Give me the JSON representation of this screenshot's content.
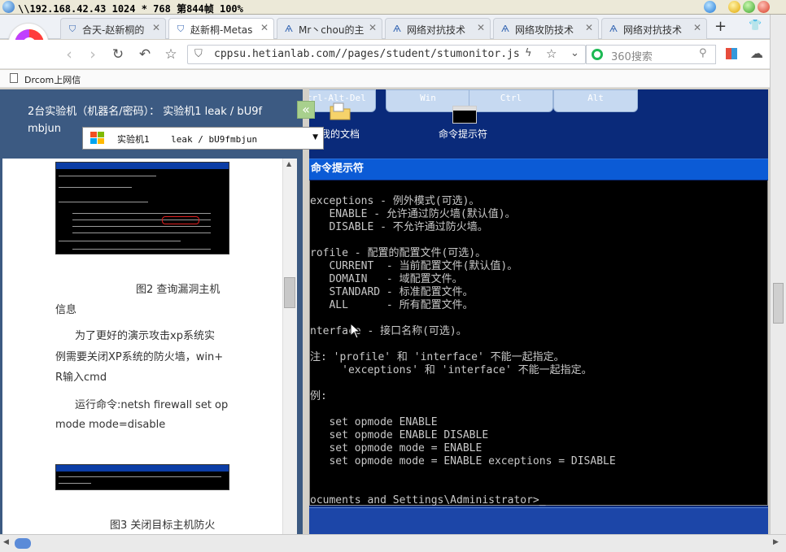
{
  "window": {
    "title": "\\\\192.168.42.43 1024 * 768 第844帧 100%"
  },
  "tabs": [
    {
      "label": "合天-赵新桐的",
      "icon": "shield-icon"
    },
    {
      "label": "赵新桐-Metas",
      "icon": "shield-icon",
      "active": true
    },
    {
      "label": "Mr丶chou的主",
      "icon": "hetian-icon"
    },
    {
      "label": "网络对抗技术",
      "icon": "hetian-icon"
    },
    {
      "label": "网络攻防技术",
      "icon": "hetian-icon"
    },
    {
      "label": "网络对抗技术",
      "icon": "hetian-icon"
    }
  ],
  "nav": {
    "url": "cppsu.hetianlab.com//pages/student/stumonitor.js",
    "search_placeholder": "360搜索"
  },
  "bookmarks": {
    "item1": "Drcom上网信"
  },
  "lab": {
    "info_line1": "2台实验机（机器名/密码）： 实验机1   leak / bU9f",
    "info_line2": "mbjun",
    "dropdown_label": "实验机1",
    "dropdown_cred": "leak / bU9fmbjun"
  },
  "doc": {
    "fig2_caption": "图2 查询漏洞主机",
    "fig2_caption2": "信息",
    "para1_l1": "为了更好的演示攻击xp系统实",
    "para1_l2": "例需要关闭XP系统的防火墙，win+",
    "para1_l3": "R输入cmd",
    "para2_l1": "运行命令:netsh firewall set op",
    "para2_l2": "mode mode=disable",
    "fig3_caption": "图3 关闭目标主机防火"
  },
  "remote": {
    "keys": [
      "Ctrl-Alt-Del",
      "Win",
      "Ctrl",
      "Alt"
    ],
    "desktop_icon1": "我的文档",
    "desktop_icon2": "命令提示符",
    "cmd_title": "命令提示符",
    "cmd_lines": [
      "exceptions - 例外模式(可选)。",
      "   ENABLE - 允许通过防火墙(默认值)。",
      "   DISABLE - 不允许通过防火墙。",
      "",
      "rofile - 配置的配置文件(可选)。",
      "   CURRENT  - 当前配置文件(默认值)。",
      "   DOMAIN   - 域配置文件。",
      "   STANDARD - 标准配置文件。",
      "   ALL      - 所有配置文件。",
      "",
      "nterface - 接口名称(可选)。",
      "",
      "注: 'profile' 和 'interface' 不能一起指定。",
      "     'exceptions' 和 'interface' 不能一起指定。",
      "",
      "例:",
      "",
      "   set opmode ENABLE",
      "   set opmode ENABLE DISABLE",
      "   set opmode mode = ENABLE",
      "   set opmode mode = ENABLE exceptions = DISABLE",
      "",
      "",
      "ocuments and Settings\\Administrator>_"
    ]
  },
  "colors": {
    "panel_bg": "#3c5a82",
    "remote_bg": "#0a2a7a",
    "cmd_title_bg": "#0b5bd6"
  }
}
